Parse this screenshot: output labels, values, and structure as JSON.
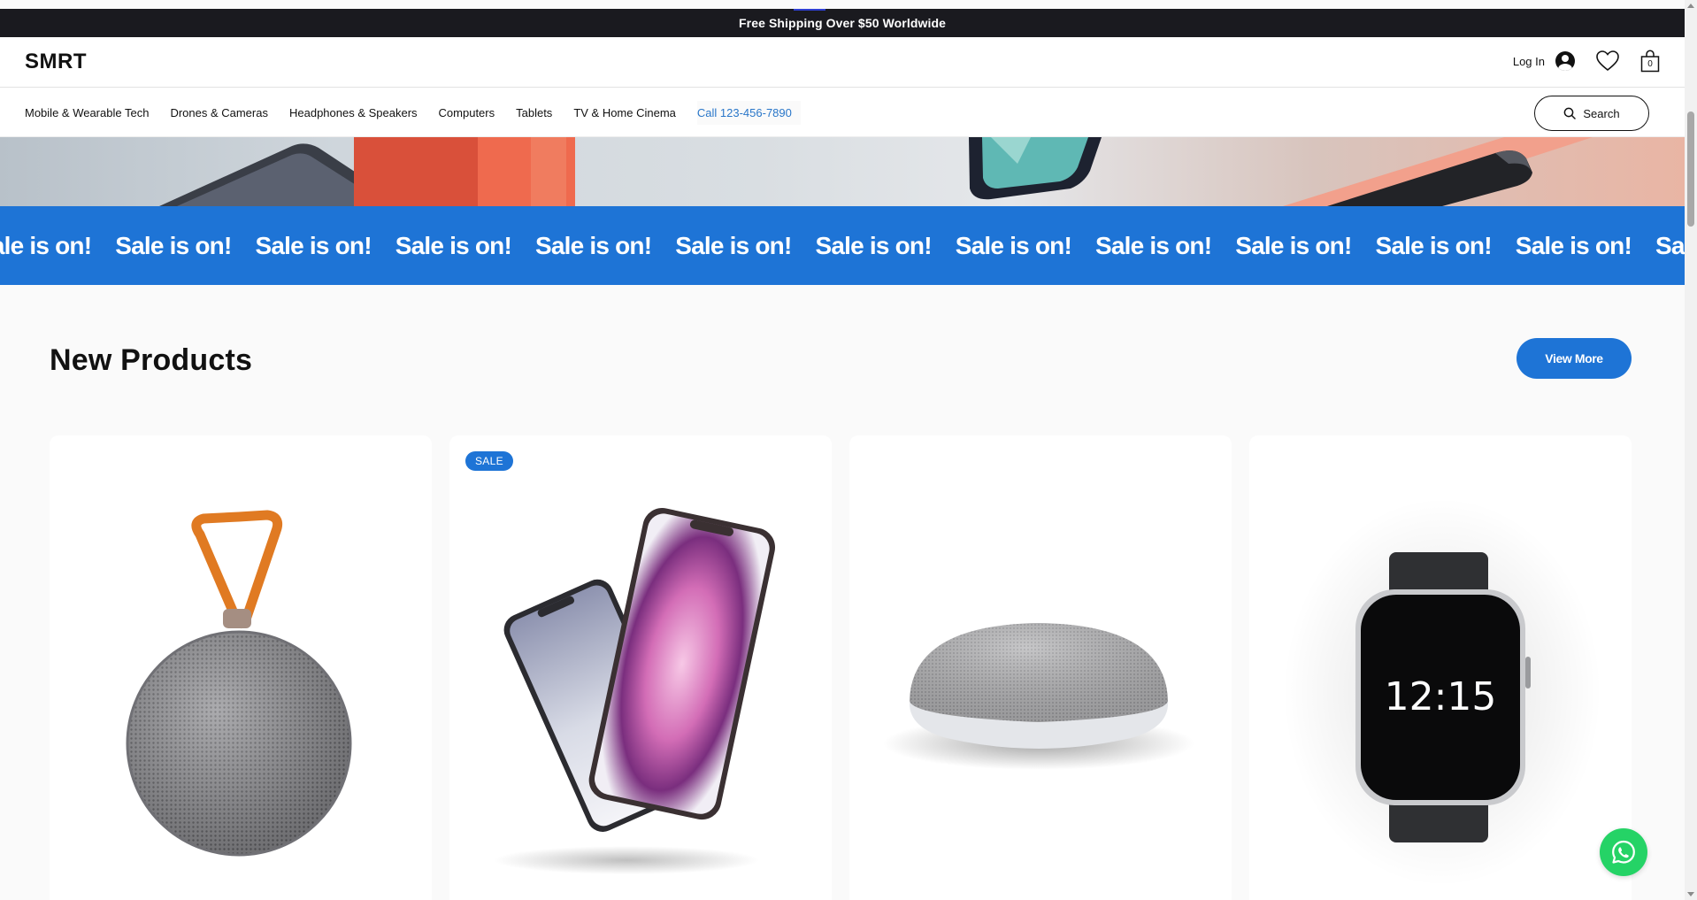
{
  "announcement": {
    "text": "Free Shipping Over $50 Worldwide"
  },
  "header": {
    "logo": "SMRT",
    "login_label": "Log In",
    "cart_count": "0",
    "icons": [
      "avatar-icon",
      "heart-icon",
      "shopping-bag-icon"
    ]
  },
  "nav": {
    "items": [
      {
        "label": "Mobile & Wearable Tech"
      },
      {
        "label": "Drones & Cameras"
      },
      {
        "label": "Headphones & Speakers"
      },
      {
        "label": "Computers"
      },
      {
        "label": "Tablets"
      },
      {
        "label": "TV & Home Cinema"
      }
    ],
    "phone": "Call 123-456-7890",
    "search_label": "Search"
  },
  "ticker": {
    "items": [
      "Sale is on!",
      "Sale is on!",
      "Sale is on!",
      "Sale is on!",
      "Sale is on!",
      "Sale is on!",
      "Sale is on!",
      "Sale is on!",
      "Sale is on!",
      "Sale is on!",
      "Sale is on!",
      "Sale is on!",
      "Sale is on!"
    ]
  },
  "products_section": {
    "title": "New Products",
    "view_more_label": "View More",
    "cards": [
      {
        "image": "speaker-icon"
      },
      {
        "image": "smartphones-icon",
        "badge": "SALE"
      },
      {
        "image": "smart-speaker-icon"
      },
      {
        "image": "smartwatch-icon",
        "watch_time": "12:15"
      }
    ]
  },
  "colors": {
    "accent": "#1e74d6",
    "announcement_bg": "#1a1a1f",
    "phone_link": "#2a77c9",
    "whatsapp": "#25d366"
  }
}
